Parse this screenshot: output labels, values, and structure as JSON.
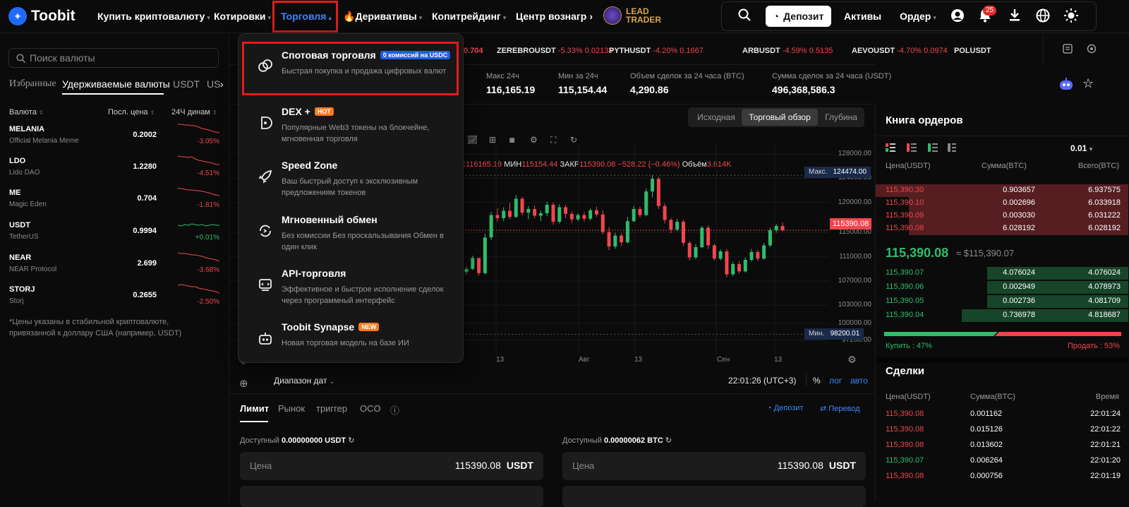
{
  "header": {
    "logo": "Toobit",
    "nav": [
      {
        "label": "Купить криптовалюту",
        "caret": "▾"
      },
      {
        "label": "Котировки",
        "caret": "▾"
      },
      {
        "label": "Торговля",
        "caret": "▴"
      },
      {
        "label": "Деривативы",
        "caret": "▾"
      },
      {
        "label": "Копитрейдинг",
        "caret": "▾"
      },
      {
        "label": "Центр вознагр",
        "caret": "›"
      }
    ],
    "lead_trader": [
      "LEAD",
      "TRADER"
    ],
    "deposit": "Депозит",
    "assets": "Активы",
    "orders": "Ордер",
    "notifications": "25"
  },
  "left": {
    "search_placeholder": "Поиск валюты",
    "tabs": [
      "Избранные",
      "Удерживаемые валюты",
      "USDT",
      "US"
    ],
    "columns": [
      "Валюта",
      "Посл. цена",
      "24Ч динам"
    ],
    "rows": [
      {
        "sym": "MELANIA",
        "name": "Official Melania Meme",
        "price": "0.2002",
        "chg": "-3.05%",
        "up": false
      },
      {
        "sym": "LDO",
        "name": "Lido DAO",
        "price": "1.2280",
        "chg": "-4.51%",
        "up": false
      },
      {
        "sym": "ME",
        "name": "Magic Eden",
        "price": "0.704",
        "chg": "-1.81%",
        "up": false
      },
      {
        "sym": "USDT",
        "name": "TetherUS",
        "price": "0.9994",
        "chg": "+0.01%",
        "up": true
      },
      {
        "sym": "NEAR",
        "name": "NEAR Protocol",
        "price": "2.699",
        "chg": "-3.68%",
        "up": false
      },
      {
        "sym": "STORJ",
        "name": "Storj",
        "price": "0.2655",
        "chg": "-2.50%",
        "up": false
      }
    ],
    "note": "*Цены указаны в стабильной криптовалюте, привязанной к доллару США (например, USDT)"
  },
  "ticker": [
    {
      "price": "0.704"
    },
    {
      "sym": "ZEREBROUSDT",
      "chg": "-5.33%",
      "price": "0.02133"
    },
    {
      "sym": "PYTHUSDT",
      "chg": "-4.20%",
      "price": "0.1667"
    },
    {
      "sym": "ARBUSDT",
      "chg": "-4.59%",
      "price": "0.5135"
    },
    {
      "sym": "AEVOUSDT",
      "chg": "-4.70%",
      "price": "0.0974"
    },
    {
      "sym": "POLUSDT"
    }
  ],
  "stats": [
    {
      "label": "Макс 24ч",
      "value": "116,165.19"
    },
    {
      "label": "Мин за 24ч",
      "value": "115,154.44"
    },
    {
      "label": "Объем сделок за 24 часа (BTC)",
      "value": "4,290.86"
    },
    {
      "label": "Сумма сделок за 24 часа (USDT)",
      "value": "496,368,586.3"
    }
  ],
  "chart_view": {
    "tabs": [
      "Исходная",
      "Торговый обзор",
      "Глубина"
    ],
    "active": 1
  },
  "ohlc": {
    "h_prefix": "С",
    "h": "116165.19",
    "l_label": "МИН",
    "l": "115154.44",
    "c_label": "ЗАКР",
    "c": "115390.08",
    "chg": "−528.22 (−0.46%)",
    "vol_label": "Объём",
    "vol": "3.614K"
  },
  "chart_data": {
    "type": "candlestick",
    "y_ticks": [
      "128000.00",
      "124000.00",
      "120000.00",
      "115000.00",
      "111000.00",
      "107000.00",
      "103000.00",
      "100000.00",
      "97200.00"
    ],
    "x_ticks": [
      "13",
      "Авг",
      "13",
      "Сен",
      "13"
    ],
    "max_label": "Макс.",
    "max_value": "124474.00",
    "min_label": "Мин.",
    "min_value": "98200.01",
    "current": "115390.08",
    "candles": [
      [
        108500,
        109400,
        108100,
        109000
      ],
      [
        109000,
        111200,
        108800,
        110800
      ],
      [
        110800,
        110600,
        107900,
        108300
      ],
      [
        108300,
        114800,
        108100,
        114200
      ],
      [
        114200,
        118400,
        113800,
        117900
      ],
      [
        117900,
        119000,
        116800,
        117400
      ],
      [
        117400,
        119200,
        116900,
        118600
      ],
      [
        118600,
        119900,
        117200,
        117600
      ],
      [
        117600,
        121200,
        117400,
        120600
      ],
      [
        120600,
        120900,
        117900,
        118300
      ],
      [
        118300,
        119400,
        117200,
        118900
      ],
      [
        118900,
        119500,
        117400,
        117800
      ],
      [
        117800,
        118600,
        116900,
        118200
      ],
      [
        118200,
        120100,
        117700,
        119600
      ],
      [
        119600,
        120000,
        116300,
        116800
      ],
      [
        116800,
        119700,
        116500,
        119200
      ],
      [
        119200,
        119600,
        117400,
        118100
      ],
      [
        118100,
        118500,
        116600,
        117200
      ],
      [
        117200,
        118200,
        116900,
        117900
      ],
      [
        117900,
        118400,
        116800,
        117300
      ],
      [
        117300,
        119000,
        117000,
        118700
      ],
      [
        118700,
        119300,
        117600,
        118000
      ],
      [
        118000,
        118700,
        114700,
        115100
      ],
      [
        115100,
        115900,
        112100,
        112700
      ],
      [
        112700,
        115000,
        112300,
        114500
      ],
      [
        114500,
        114900,
        112800,
        113400
      ],
      [
        113400,
        117600,
        113200,
        116900
      ],
      [
        116900,
        119400,
        116700,
        118900
      ],
      [
        118900,
        119300,
        117500,
        117900
      ],
      [
        117900,
        122300,
        117700,
        121800
      ],
      [
        121800,
        124474,
        120800,
        123900
      ],
      [
        123900,
        124200,
        118900,
        119400
      ],
      [
        119400,
        119800,
        116500,
        117100
      ],
      [
        117100,
        117400,
        114900,
        115500
      ],
      [
        115500,
        117300,
        115200,
        116800
      ],
      [
        116800,
        117100,
        112800,
        113300
      ],
      [
        113300,
        113600,
        110400,
        110900
      ],
      [
        110900,
        113100,
        110600,
        112600
      ],
      [
        112600,
        116100,
        112400,
        115800
      ],
      [
        115800,
        116200,
        112300,
        112900
      ],
      [
        112900,
        113200,
        110400,
        110700
      ],
      [
        110700,
        112200,
        110400,
        111900
      ],
      [
        111900,
        112300,
        107600,
        108100
      ],
      [
        108100,
        110200,
        107800,
        109800
      ],
      [
        109800,
        110300,
        108200,
        108600
      ],
      [
        108600,
        110900,
        108400,
        110500
      ],
      [
        110500,
        112300,
        110200,
        111800
      ],
      [
        111800,
        112100,
        110300,
        110700
      ],
      [
        110700,
        113300,
        110500,
        112900
      ],
      [
        112900,
        115800,
        112600,
        115400
      ],
      [
        115400,
        116400,
        115000,
        116100
      ],
      [
        116100,
        116700,
        115200,
        115390
      ]
    ]
  },
  "chart_footer": {
    "range": "Диапазон дат",
    "time": "22:01:26 (UTC+3)",
    "percent": "%",
    "log": "лог",
    "auto": "авто"
  },
  "order_form": {
    "tabs": [
      "Лимит",
      "Рынок",
      "триггер",
      "OCO"
    ],
    "deposit": "Депозит",
    "transfer": "Перевод",
    "avail_label": "Доступный",
    "left_avail": "0.00000000 USDT",
    "right_avail": "0.00000062 BTC",
    "price_label": "Цена",
    "price": "115390.08",
    "unit": "USDT"
  },
  "dropdown": [
    {
      "title": "Спотовая торговля",
      "tag": "0 комиссий на USDC",
      "tag_color": "#1f5fe0",
      "desc": "Быстрая покупка и продажа цифровых валют",
      "icon": "spot-icon"
    },
    {
      "title": "DEX +",
      "tag": "HOT",
      "tag_color": "#ff7a1a",
      "desc": "Популярные Web3 токены на блокчейне, мгновенная торговля",
      "icon": "dex-icon"
    },
    {
      "title": "Speed Zone",
      "tag": "",
      "desc": "Ваш быстрый доступ к эксклюзивным предложениям токенов",
      "icon": "rocket-icon"
    },
    {
      "title": "Мгновенный обмен",
      "tag": "",
      "desc": "Без комиссии Без проскальзывания Обмен в один клик",
      "icon": "swap-icon"
    },
    {
      "title": "API-торговля",
      "tag": "",
      "desc": "Эффективное и быстрое исполнение сделок через программный интерфейс",
      "icon": "api-icon"
    },
    {
      "title": "Toobit Synapse",
      "tag": "NEW",
      "tag_color": "#ff7a1a",
      "desc": "Новая торговая модель на базе ИИ",
      "icon": "robot-icon"
    }
  ],
  "orderbook": {
    "title": "Книга ордеров",
    "precision": "0.01",
    "columns": [
      "Цена(USDT)",
      "Сумма(BTC)",
      "Всего(BTC)"
    ],
    "asks": [
      {
        "p": "115,390.30",
        "a": "0.903657",
        "t": "6.937575",
        "f": 1.0
      },
      {
        "p": "115,390.10",
        "a": "0.002696",
        "t": "6.033918",
        "f": 0.87
      },
      {
        "p": "115,390.09",
        "a": "0.003030",
        "t": "6.031222",
        "f": 0.87
      },
      {
        "p": "115,390.08",
        "a": "6.028192",
        "t": "6.028192",
        "f": 0.87
      }
    ],
    "mid_price": "115,390.08",
    "mid_usd": "≈ $115,390.07",
    "bids": [
      {
        "p": "115,390.07",
        "a": "4.076024",
        "t": "4.076024",
        "f": 0.56
      },
      {
        "p": "115,390.06",
        "a": "0.002949",
        "t": "4.078973",
        "f": 0.56
      },
      {
        "p": "115,390.05",
        "a": "0.002736",
        "t": "4.081709",
        "f": 0.56
      },
      {
        "p": "115,390.04",
        "a": "0.736978",
        "t": "4.818687",
        "f": 0.66
      }
    ],
    "buy": "Купить :  47%",
    "sell": "Продать :  53%",
    "buy_ratio": 0.47
  },
  "trades": {
    "title": "Сделки",
    "columns": [
      "Цена(USDT)",
      "Сумма(BTC)",
      "Время"
    ],
    "rows": [
      {
        "p": "115,390.08",
        "a": "0.001162",
        "t": "22:01:24",
        "up": false
      },
      {
        "p": "115,390.08",
        "a": "0.015126",
        "t": "22:01:22",
        "up": false
      },
      {
        "p": "115,390.08",
        "a": "0.013602",
        "t": "22:01:21",
        "up": false
      },
      {
        "p": "115,390.07",
        "a": "0.006264",
        "t": "22:01:20",
        "up": true
      },
      {
        "p": "115,390.08",
        "a": "0.000756",
        "t": "22:01:19",
        "up": false
      }
    ]
  },
  "colors": {
    "accent": "#3b86ff",
    "up": "#2ebd6b",
    "down": "#f0464e",
    "highlight": "#e21b1b"
  }
}
